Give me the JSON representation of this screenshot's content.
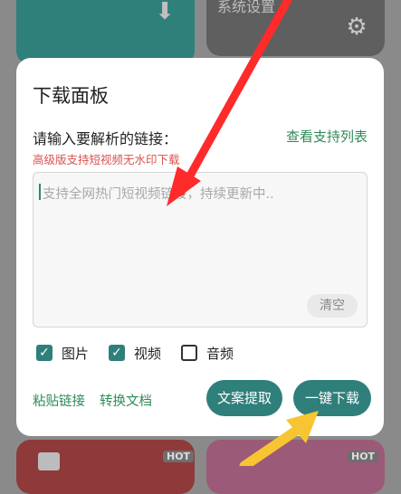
{
  "background": {
    "tile_top_right_label": "系统设置",
    "hot_badge": "HOT"
  },
  "dialog": {
    "title": "下载面板",
    "prompt": "请输入要解析的链接：",
    "support_link": "查看支持列表",
    "promo": "高级版支持短视频无水印下载",
    "input": {
      "placeholder": "支持全网热门短视频链接，持续更新中..",
      "value": ""
    },
    "clear_label": "清空",
    "options": [
      {
        "label": "图片",
        "checked": true
      },
      {
        "label": "视频",
        "checked": true
      },
      {
        "label": "音频",
        "checked": false
      }
    ],
    "paste_link": "粘贴链接",
    "convert_link": "转换文档",
    "extract_button": "文案提取",
    "onekey_button": "一键下载"
  },
  "colors": {
    "accent_green": "#2f7f7b",
    "link_green": "#2e8b57",
    "promo_red": "#d9534f",
    "annotation_red_arrow": "#ff2a2a",
    "annotation_yellow_arrow": "#f7c531"
  }
}
